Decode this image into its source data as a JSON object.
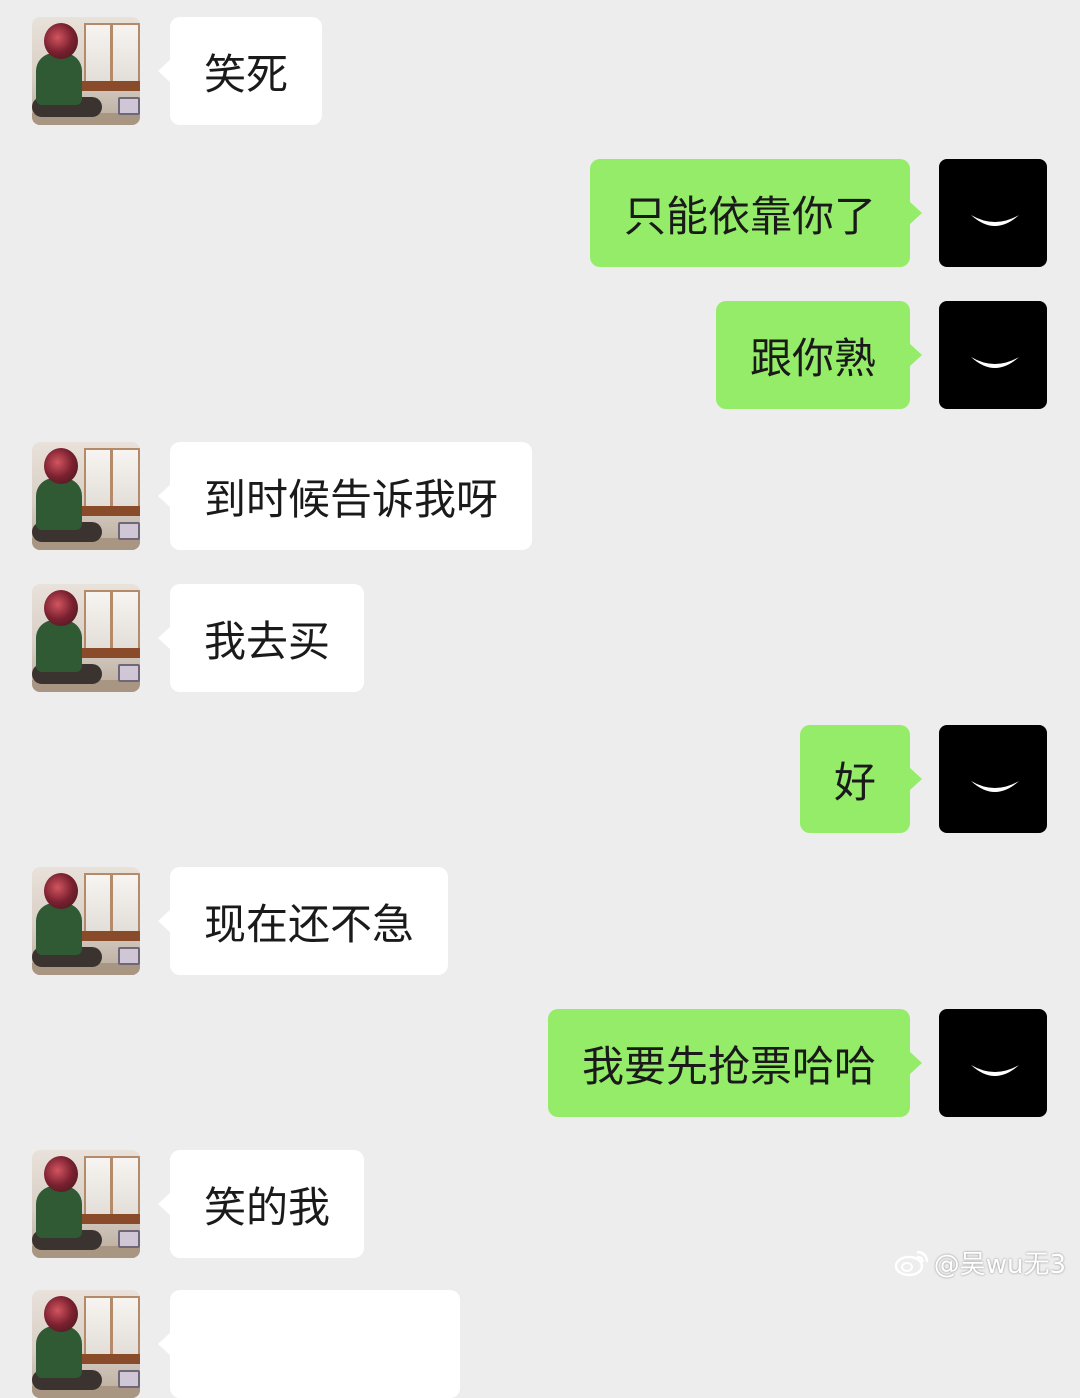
{
  "messages": [
    {
      "side": "left",
      "text": "笑死"
    },
    {
      "side": "right",
      "text": "只能依靠你了"
    },
    {
      "side": "right",
      "text": "跟你熟"
    },
    {
      "side": "left",
      "text": "到时候告诉我呀"
    },
    {
      "side": "left",
      "text": "我去买"
    },
    {
      "side": "right",
      "text": "好"
    },
    {
      "side": "left",
      "text": "现在还不急"
    },
    {
      "side": "right",
      "text": "我要先抢票哈哈"
    },
    {
      "side": "left",
      "text": "笑的我"
    }
  ],
  "watermark": {
    "handle": "@吴wu无3",
    "icon": "weibo-icon"
  },
  "colors": {
    "background": "#ededed",
    "incoming_bubble": "#ffffff",
    "outgoing_bubble": "#95ec69",
    "text": "#1a1a1a"
  }
}
